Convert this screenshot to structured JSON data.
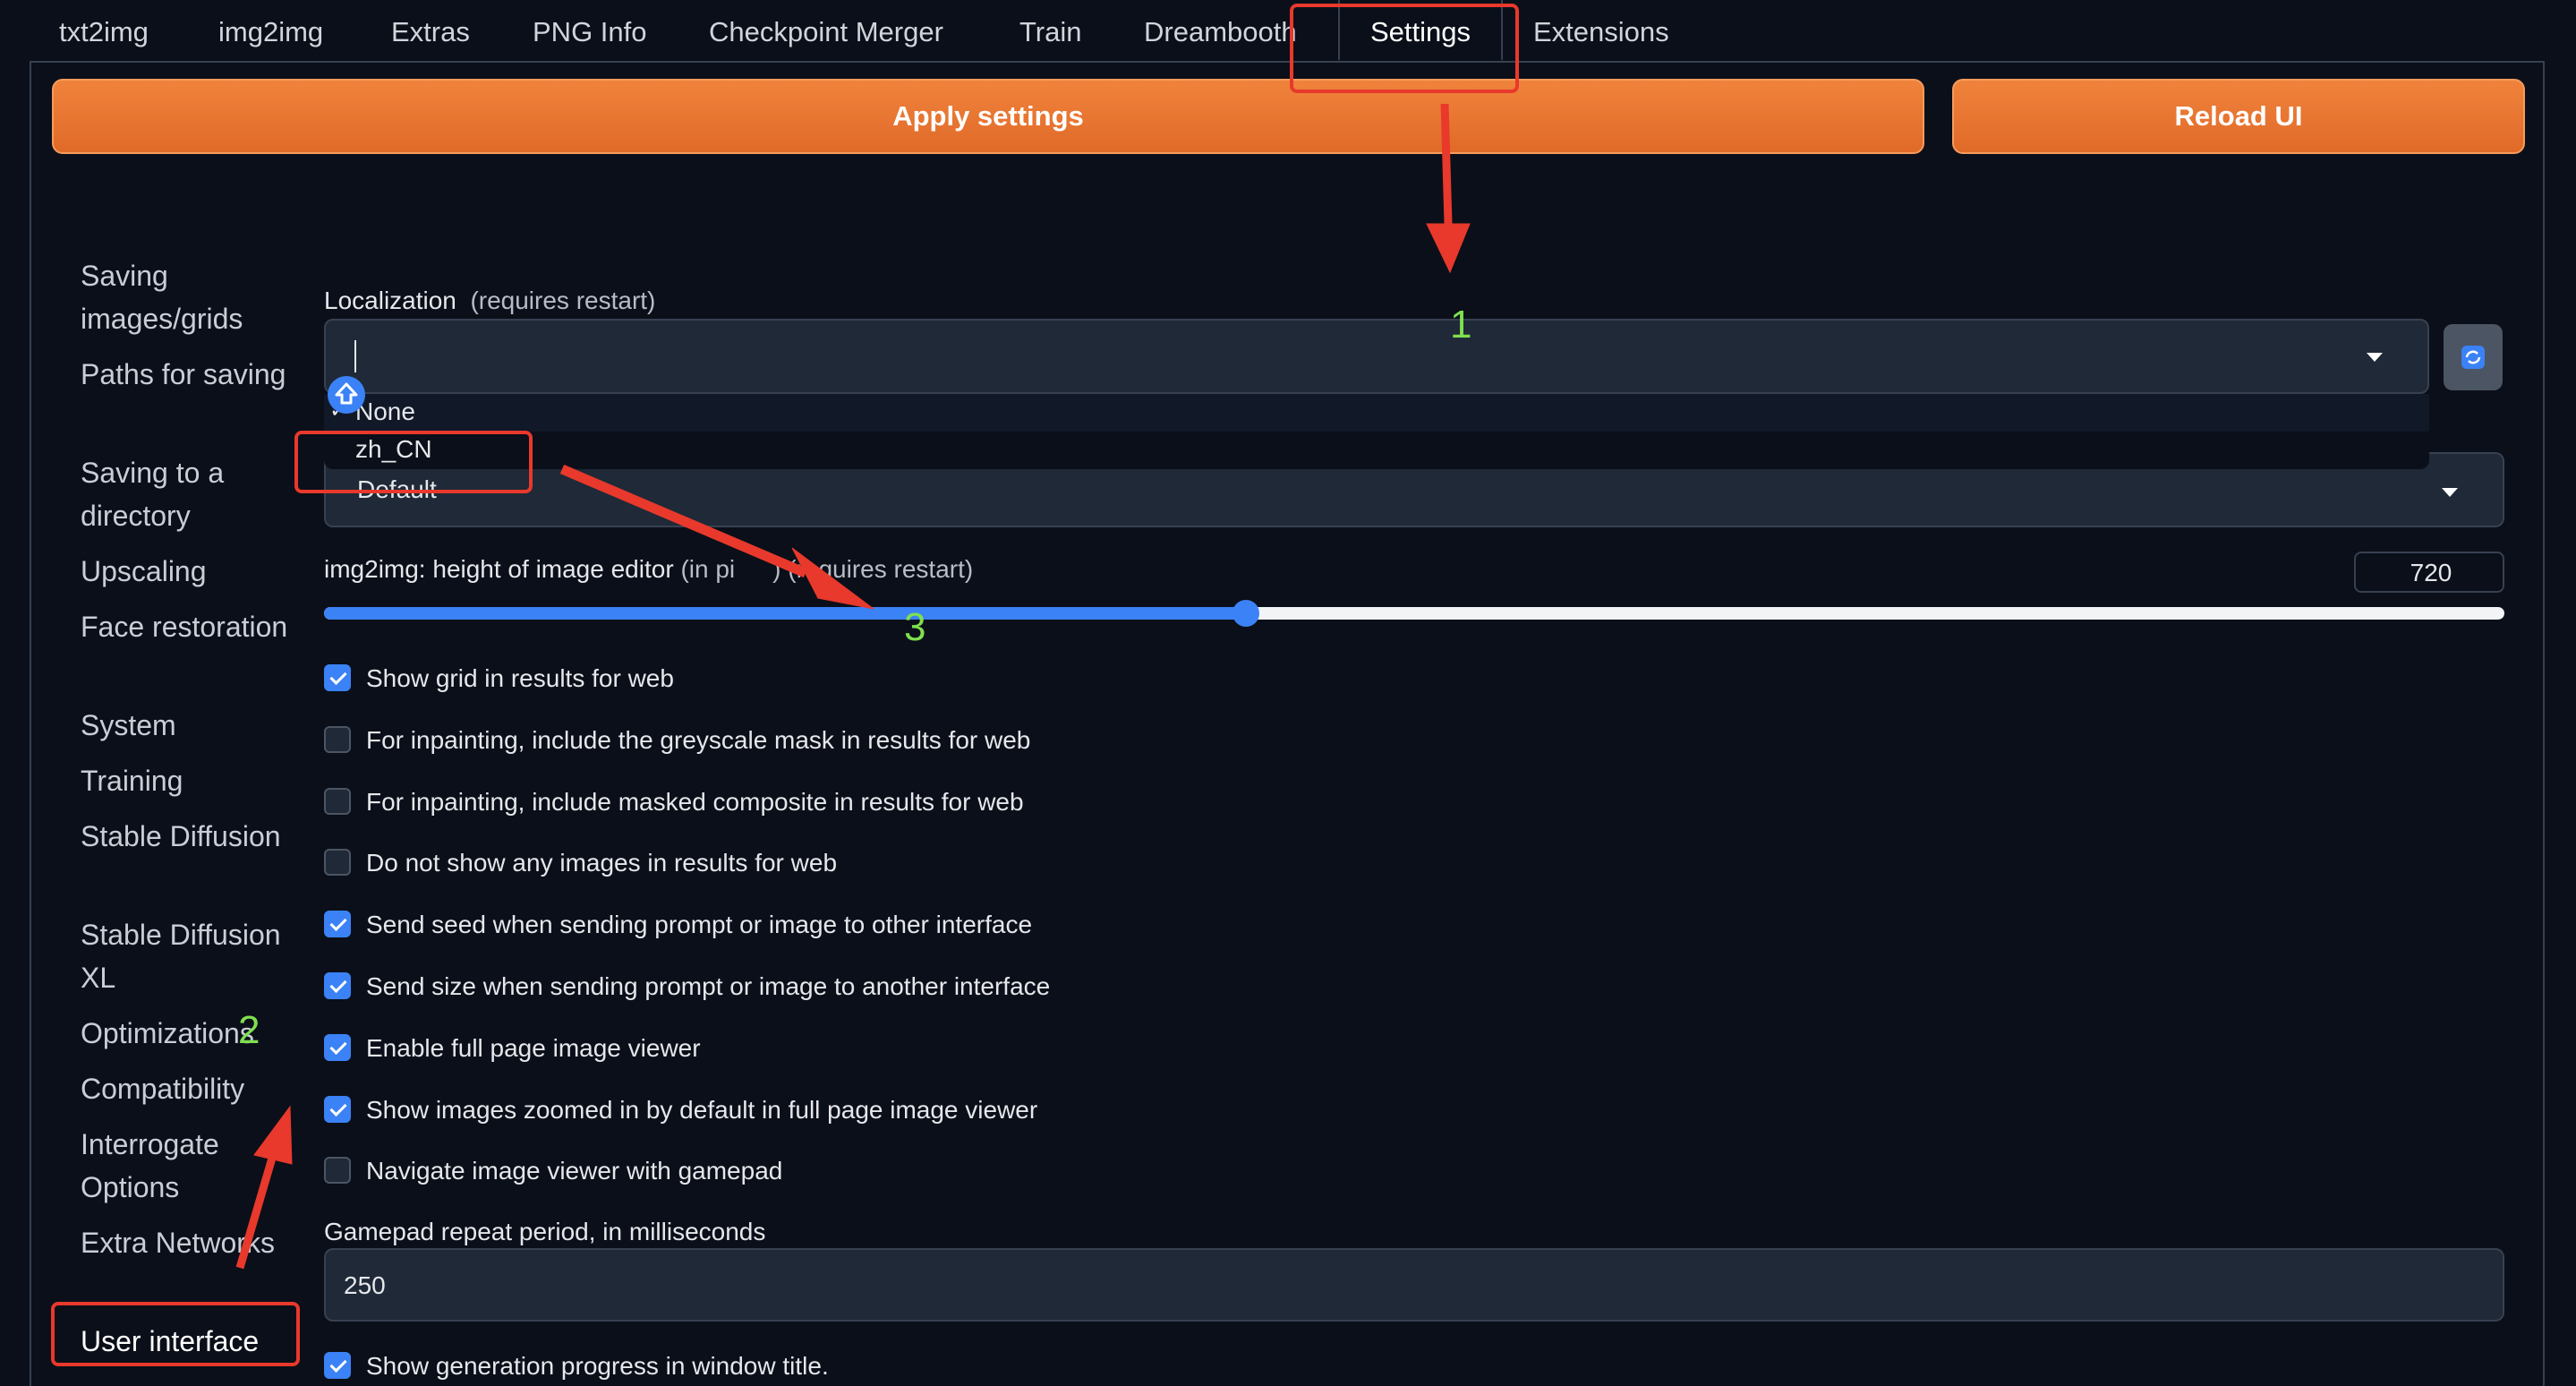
{
  "tabs": [
    "txt2img",
    "img2img",
    "Extras",
    "PNG Info",
    "Checkpoint Merger",
    "Train",
    "Dreambooth",
    "Settings",
    "Extensions"
  ],
  "active_tab": "Settings",
  "buttons": {
    "apply": "Apply settings",
    "reload": "Reload UI"
  },
  "sidebar": [
    "Saving images/grids",
    "Paths for saving",
    "Saving to a directory",
    "Upscaling",
    "Face restoration",
    "System",
    "Training",
    "Stable Diffusion",
    "Stable Diffusion XL",
    "Optimizations",
    "Compatibility",
    "Interrogate Options",
    "Extra Networks",
    "User interface"
  ],
  "sidebar_selected": "User interface",
  "localization": {
    "label": "Localization",
    "note": "(requires restart)",
    "options": [
      "None",
      "zh_CN"
    ],
    "checked_option": "None",
    "refresh_icon": "refresh-icon"
  },
  "second_select": {
    "value": "Default"
  },
  "image_editor": {
    "label_start": "img2img: height of image editor",
    "label_unit": "(in pixels)",
    "label_unit_visible": "(in pi",
    "label_unit_tail": ")",
    "label_end": "(requires restart)",
    "value": "720",
    "slider_fraction": 0.4227
  },
  "checkboxes": [
    {
      "label": "Show grid in results for web",
      "checked": true
    },
    {
      "label": "For inpainting, include the greyscale mask in results for web",
      "checked": false
    },
    {
      "label": "For inpainting, include masked composite in results for web",
      "checked": false
    },
    {
      "label": "Do not show any images in results for web",
      "checked": false
    },
    {
      "label": "Send seed when sending prompt or image to other interface",
      "checked": true
    },
    {
      "label": "Send size when sending prompt or image to another interface",
      "checked": true
    },
    {
      "label": "Enable full page image viewer",
      "checked": true
    },
    {
      "label": "Show images zoomed in by default in full page image viewer",
      "checked": true
    },
    {
      "label": "Navigate image viewer with gamepad",
      "checked": false
    }
  ],
  "gamepad": {
    "label": "Gamepad repeat period, in milliseconds",
    "value": "250"
  },
  "last_checkbox": {
    "label": "Show generation progress in window title.",
    "checked": true
  },
  "annotations": {
    "step1": "1",
    "step2": "2",
    "step3": "3"
  },
  "colors": {
    "accent_orange": "#e8722e",
    "annotation_red": "#e8392c",
    "annotation_green": "#7ee04f",
    "checkbox_blue": "#3b82f6"
  }
}
